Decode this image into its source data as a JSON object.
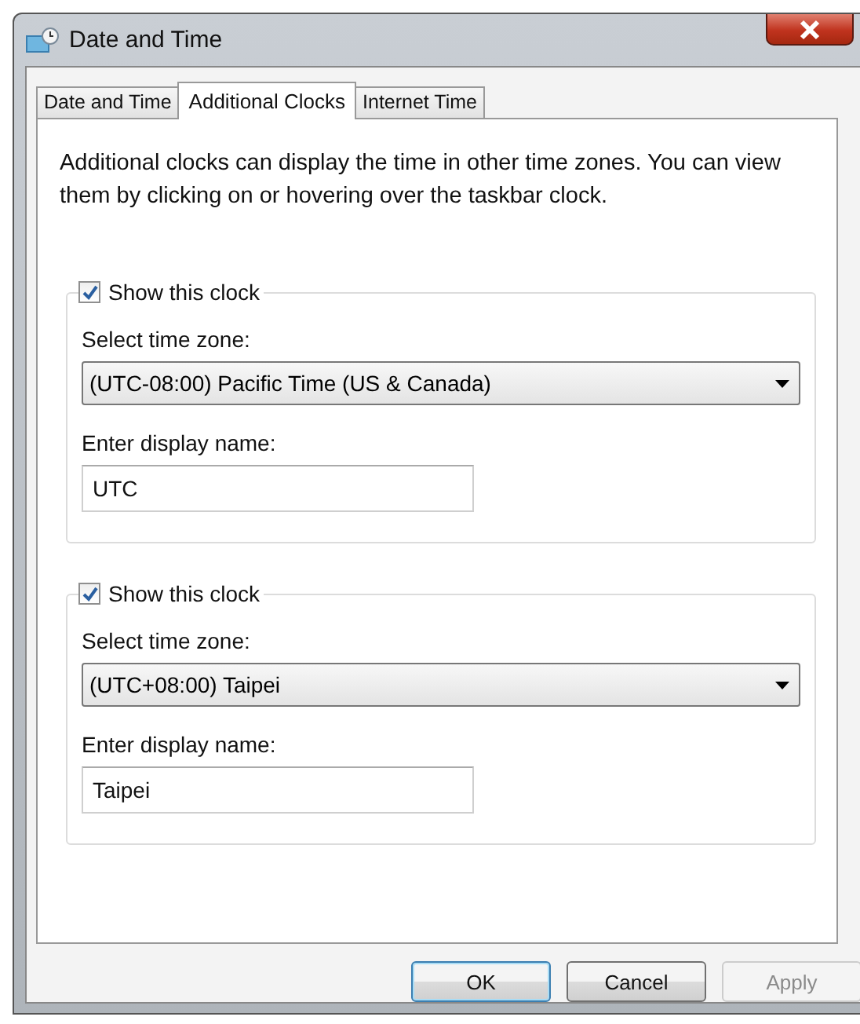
{
  "window": {
    "title": "Date and Time"
  },
  "tabs": [
    {
      "label": "Date and Time",
      "selected": false
    },
    {
      "label": "Additional Clocks",
      "selected": true
    },
    {
      "label": "Internet Time",
      "selected": false
    }
  ],
  "description": "Additional clocks can display the time in other time zones. You can view them by clicking on or hovering over the taskbar clock.",
  "clocks": [
    {
      "show_label": "Show this clock",
      "checked": true,
      "zone_label": "Select time zone:",
      "zone_value": "(UTC-08:00) Pacific Time (US & Canada)",
      "name_label": "Enter display name:",
      "name_value": "UTC"
    },
    {
      "show_label": "Show this clock",
      "checked": true,
      "zone_label": "Select time zone:",
      "zone_value": "(UTC+08:00) Taipei",
      "name_label": "Enter display name:",
      "name_value": "Taipei"
    }
  ],
  "buttons": [
    {
      "label": "OK",
      "default": true,
      "disabled": false
    },
    {
      "label": "Cancel",
      "default": false,
      "disabled": false
    },
    {
      "label": "Apply",
      "default": false,
      "disabled": true
    }
  ]
}
